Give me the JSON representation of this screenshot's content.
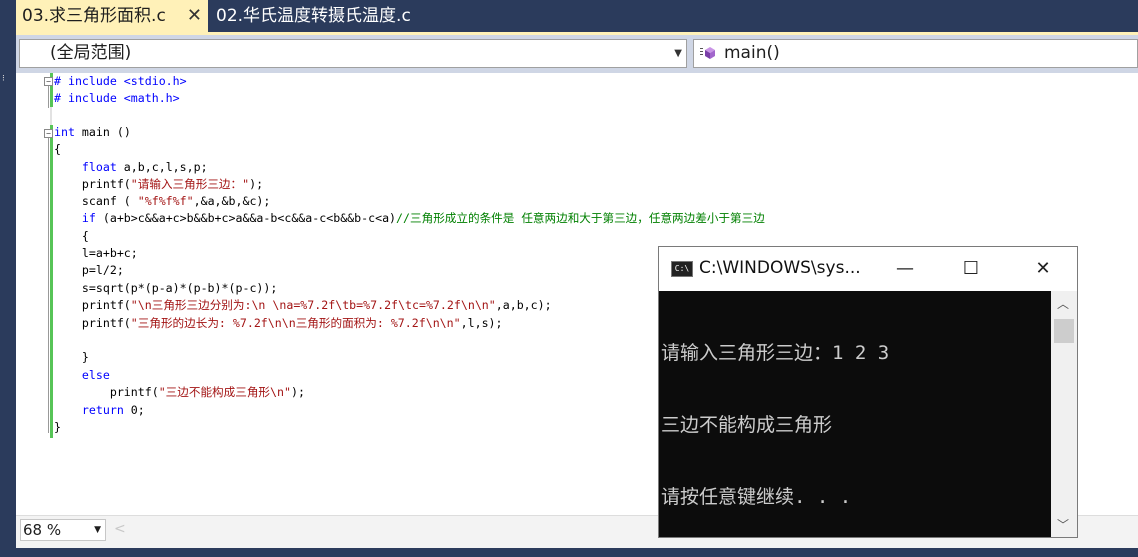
{
  "tabs": [
    {
      "label": "03.求三角形面积.c",
      "active": true
    },
    {
      "label": "02.华氏温度转摄氏温度.c",
      "active": false
    }
  ],
  "navbar": {
    "scope": "(全局范围)",
    "member": "main()"
  },
  "code_lines": [
    "# include <stdio.h>",
    "# include <math.h>",
    "",
    "int main ()",
    "{",
    "    float a,b,c,l,s,p;",
    "    printf(\"请输入三角形三边：\");",
    "    scanf ( \"%f%f%f\",&a,&b,&c);",
    "    if (a+b>c&&a+c>b&&b+c>a&&a-b<c&&a-c<b&&b-c<a)//三角形成立的条件是 任意两边和大于第三边，任意两边差小于第三边",
    "    {",
    "    l=a+b+c;",
    "    p=l/2;",
    "    s=sqrt(p*(p-a)*(p-b)*(p-c));",
    "    printf(\"\\n三角形三边分别为:\\n \\na=%7.2f\\tb=%7.2f\\tc=%7.2f\\n\\n\",a,b,c);",
    "    printf(\"三角形的边长为: %7.2f\\n\\n三角形的面积为: %7.2f\\n\\n\",l,s);",
    "",
    "    }",
    "    else",
    "        printf(\"三边不能构成三角形\\n\");",
    "    return 0;",
    "}"
  ],
  "status": {
    "zoom": "68 %"
  },
  "console": {
    "title": "C:\\WINDOWS\\sys...",
    "icon": "console-app-icon",
    "lines": [
      "请输入三角形三边：1 2 3",
      "三边不能构成三角形",
      "请按任意键继续. . ."
    ]
  },
  "colors": {
    "keyword": "#0000ff",
    "string": "#a31515",
    "comment": "#008000",
    "active_tab": "#fff1b8",
    "chrome": "#2b3b5c"
  }
}
